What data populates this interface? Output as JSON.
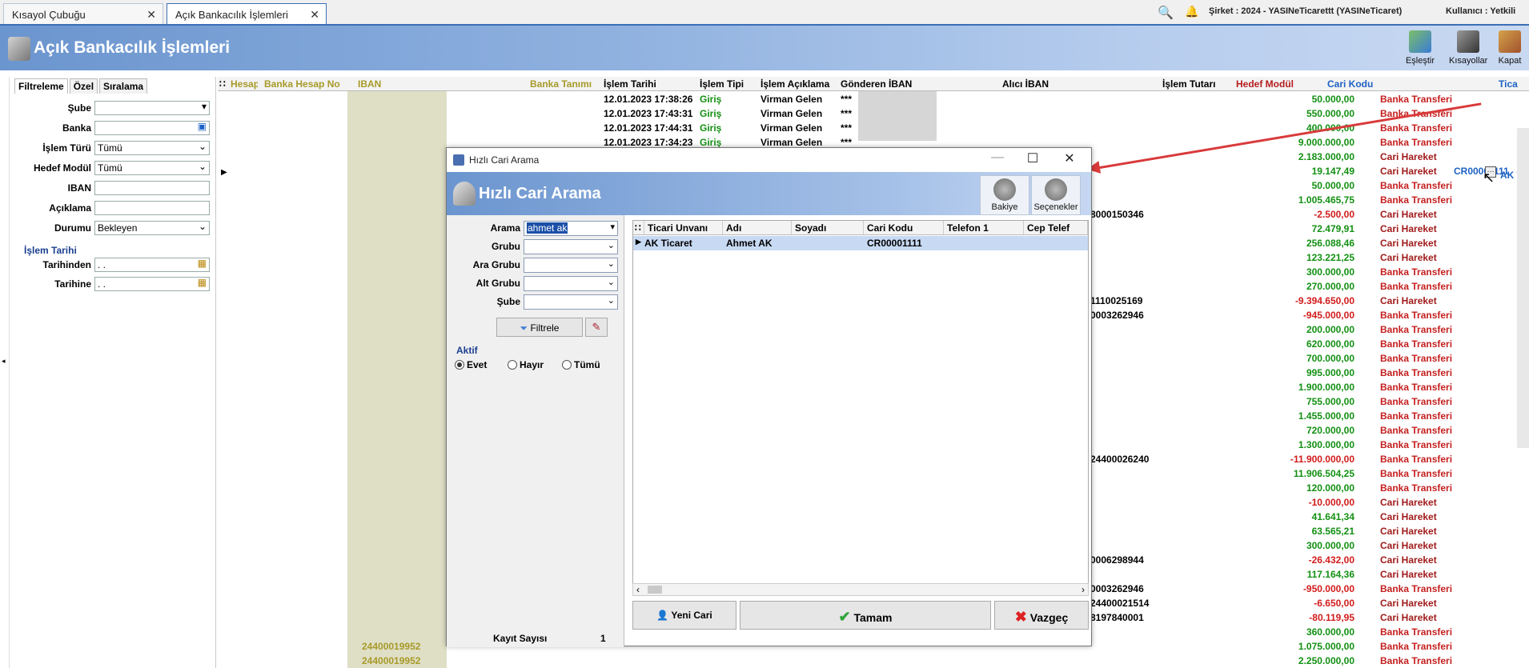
{
  "tabs": [
    {
      "label": "Kısayol Çubuğu"
    },
    {
      "label": "Açık Bankacılık İşlemleri"
    }
  ],
  "topbar": {
    "company": "Şirket : 2024 - YASINeTicarettt (YASINeTicaret)",
    "user": "Kullanıcı : Yetkili"
  },
  "header": {
    "title": "Açık Bankacılık İşlemleri",
    "buttons": [
      "Eşleştir",
      "Kısayollar",
      "Kapat"
    ]
  },
  "leftpanel": {
    "tabs": [
      "Filtreleme",
      "Özel",
      "Sıralama"
    ],
    "fields": [
      {
        "label": "Şube",
        "value": ""
      },
      {
        "label": "Banka",
        "value": ""
      },
      {
        "label": "İşlem Türü",
        "value": "Tümü"
      },
      {
        "label": "Hedef Modül",
        "value": "Tümü"
      },
      {
        "label": "IBAN",
        "value": ""
      },
      {
        "label": "Açıklama",
        "value": ""
      },
      {
        "label": "Durumu",
        "value": "Bekleyen"
      }
    ],
    "date_group": "İşlem Tarihi",
    "date_fields": [
      {
        "label": "Tarihinden",
        "value": ". ."
      },
      {
        "label": "Tarihine",
        "value": ". ."
      }
    ]
  },
  "grid": {
    "columns": [
      "Hesap",
      "Banka Hesap No",
      "IBAN",
      "Banka Tanımı",
      "İşlem Tarihi",
      "İşlem Tipi",
      "İşlem Açıklama",
      "Gönderen İBAN",
      "Alıcı İBAN",
      "İşlem Tutarı",
      "Hedef Modül",
      "Cari Kodu",
      "Tica"
    ],
    "rows": [
      {
        "date": "12.01.2023 17:38:26",
        "type": "Giriş",
        "desc": "Virman Gelen",
        "gond": "***",
        "amount": "50.000,00",
        "module": "Banka Transferi",
        "code": ""
      },
      {
        "date": "12.01.2023 17:43:31",
        "type": "Giriş",
        "desc": "Virman Gelen",
        "gond": "***",
        "amount": "550.000,00",
        "module": "Banka Transferi",
        "code": ""
      },
      {
        "date": "12.01.2023 17:44:31",
        "type": "Giriş",
        "desc": "Virman Gelen",
        "gond": "***",
        "amount": "400.000,00",
        "module": "Banka Transferi",
        "code": ""
      },
      {
        "date": "12.01.2023 17:34:23",
        "type": "Giriş",
        "desc": "Virman Gelen",
        "gond": "***",
        "amount": "9.000.000,00",
        "module": "Banka Transferi",
        "code": ""
      },
      {
        "date": "",
        "type": "",
        "desc": "",
        "gond": "",
        "amount": "2.183.000,00",
        "module": "Cari Hareket",
        "code": ""
      },
      {
        "date": "",
        "type": "",
        "desc": "",
        "gond": "",
        "amount": "19.147,49",
        "module": "Cari Hareket",
        "code": "CR00001111"
      },
      {
        "date": "",
        "type": "",
        "desc": "",
        "gond": "",
        "amount": "50.000,00",
        "module": "Banka Transferi",
        "code": ""
      },
      {
        "date": "",
        "type": "",
        "desc": "",
        "gond": "",
        "amount": "1.005.465,75",
        "module": "Banka Transferi",
        "code": ""
      },
      {
        "date": "",
        "type": "",
        "desc": "",
        "gond": "",
        "amount": "-2.500,00",
        "module": "Cari Hareket",
        "code": ""
      },
      {
        "date": "",
        "type": "",
        "desc": "",
        "gond": "",
        "amount": "72.479,91",
        "module": "Cari Hareket",
        "code": ""
      },
      {
        "date": "",
        "type": "",
        "desc": "",
        "gond": "",
        "amount": "256.088,46",
        "module": "Cari Hareket",
        "code": ""
      },
      {
        "date": "",
        "type": "",
        "desc": "",
        "gond": "",
        "amount": "123.221,25",
        "module": "Cari Hareket",
        "code": ""
      },
      {
        "date": "",
        "type": "",
        "desc": "",
        "gond": "",
        "amount": "300.000,00",
        "module": "Banka Transferi",
        "code": ""
      },
      {
        "date": "",
        "type": "",
        "desc": "",
        "gond": "",
        "amount": "270.000,00",
        "module": "Banka Transferi",
        "code": ""
      },
      {
        "date": "",
        "type": "",
        "desc": "",
        "gond": "",
        "amount": "-9.394.650,00",
        "module": "Cari Hareket",
        "code": ""
      },
      {
        "date": "",
        "type": "",
        "desc": "",
        "gond": "",
        "amount": "-945.000,00",
        "module": "Banka Transferi",
        "code": ""
      },
      {
        "date": "",
        "type": "",
        "desc": "",
        "gond": "",
        "amount": "200.000,00",
        "module": "Banka Transferi",
        "code": ""
      },
      {
        "date": "",
        "type": "",
        "desc": "",
        "gond": "",
        "amount": "620.000,00",
        "module": "Banka Transferi",
        "code": ""
      },
      {
        "date": "",
        "type": "",
        "desc": "",
        "gond": "",
        "amount": "700.000,00",
        "module": "Banka Transferi",
        "code": ""
      },
      {
        "date": "",
        "type": "",
        "desc": "",
        "gond": "",
        "amount": "995.000,00",
        "module": "Banka Transferi",
        "code": ""
      },
      {
        "date": "",
        "type": "",
        "desc": "",
        "gond": "",
        "amount": "1.900.000,00",
        "module": "Banka Transferi",
        "code": ""
      },
      {
        "date": "",
        "type": "",
        "desc": "",
        "gond": "",
        "amount": "755.000,00",
        "module": "Banka Transferi",
        "code": ""
      },
      {
        "date": "",
        "type": "",
        "desc": "",
        "gond": "",
        "amount": "1.455.000,00",
        "module": "Banka Transferi",
        "code": ""
      },
      {
        "date": "",
        "type": "",
        "desc": "",
        "gond": "",
        "amount": "720.000,00",
        "module": "Banka Transferi",
        "code": ""
      },
      {
        "date": "",
        "type": "",
        "desc": "",
        "gond": "",
        "amount": "1.300.000,00",
        "module": "Banka Transferi",
        "code": ""
      },
      {
        "date": "",
        "type": "",
        "desc": "",
        "gond": "",
        "amount": "-11.900.000,00",
        "module": "Banka Transferi",
        "code": ""
      },
      {
        "date": "",
        "type": "",
        "desc": "",
        "gond": "",
        "amount": "11.906.504,25",
        "module": "Banka Transferi",
        "code": ""
      },
      {
        "date": "",
        "type": "",
        "desc": "",
        "gond": "",
        "amount": "120.000,00",
        "module": "Banka Transferi",
        "code": ""
      },
      {
        "date": "",
        "type": "",
        "desc": "",
        "gond": "",
        "amount": "-10.000,00",
        "module": "Cari Hareket",
        "code": ""
      },
      {
        "date": "",
        "type": "",
        "desc": "",
        "gond": "",
        "amount": "41.641,34",
        "module": "Cari Hareket",
        "code": ""
      },
      {
        "date": "",
        "type": "",
        "desc": "",
        "gond": "",
        "amount": "63.565,21",
        "module": "Cari Hareket",
        "code": ""
      },
      {
        "date": "",
        "type": "",
        "desc": "",
        "gond": "",
        "amount": "300.000,00",
        "module": "Cari Hareket",
        "code": ""
      },
      {
        "date": "",
        "type": "",
        "desc": "",
        "gond": "",
        "amount": "-26.432,00",
        "module": "Cari Hareket",
        "code": ""
      },
      {
        "date": "",
        "type": "",
        "desc": "",
        "gond": "",
        "amount": "117.164,36",
        "module": "Cari Hareket",
        "code": ""
      },
      {
        "date": "",
        "type": "",
        "desc": "",
        "gond": "",
        "amount": "-950.000,00",
        "module": "Banka Transferi",
        "code": ""
      },
      {
        "date": "",
        "type": "",
        "desc": "",
        "gond": "",
        "amount": "-6.650,00",
        "module": "Cari Hareket",
        "code": ""
      },
      {
        "date": "",
        "type": "",
        "desc": "",
        "gond": "",
        "amount": "-80.119,95",
        "module": "Cari Hareket",
        "code": ""
      },
      {
        "date": "",
        "type": "",
        "desc": "",
        "gond": "",
        "amount": "360.000,00",
        "module": "Banka Transferi",
        "code": ""
      },
      {
        "date": "",
        "type": "",
        "desc": "",
        "gond": "",
        "amount": "1.075.000,00",
        "module": "Banka Transferi",
        "code": ""
      },
      {
        "date": "",
        "type": "",
        "desc": "",
        "gond": "",
        "amount": "2.250.000,00",
        "module": "Banka Transferi",
        "code": ""
      }
    ],
    "partial_texts": [
      {
        "text": "8000150346",
        "row": 8
      },
      {
        "text": "1110025169",
        "row": 14
      },
      {
        "text": "0003262946",
        "row": 15
      },
      {
        "text": "24400026240",
        "row": 25
      },
      {
        "text": "0006298944",
        "row": 32
      },
      {
        "text": "0003262946",
        "row": 34
      },
      {
        "text": "24400021514",
        "row": 35
      },
      {
        "text": "8197840001",
        "row": 36
      },
      {
        "text": "24400019952",
        "row": 38
      },
      {
        "text": "24400019952",
        "row": 39
      }
    ],
    "trailing_code": "AK T"
  },
  "dialog": {
    "window_title": "Hızlı Cari Arama",
    "header_title": "Hızlı Cari Arama",
    "header_buttons": [
      "Bakiye",
      "Seçenekler"
    ],
    "fields": [
      {
        "label": "Arama",
        "value": "ahmet ak"
      },
      {
        "label": "Grubu",
        "value": ""
      },
      {
        "label": "Ara Grubu",
        "value": ""
      },
      {
        "label": "Alt Grubu",
        "value": ""
      },
      {
        "label": "Şube",
        "value": ""
      }
    ],
    "filter_button": "Filtrele",
    "aktif_label": "Aktif",
    "radios": [
      {
        "label": "Evet",
        "checked": true
      },
      {
        "label": "Hayır",
        "checked": false
      },
      {
        "label": "Tümü",
        "checked": false
      }
    ],
    "kayit_label": "Kayıt Sayısı",
    "kayit_value": "1",
    "columns": [
      "Ticari Unvanı",
      "Adı",
      "Soyadı",
      "Cari Kodu",
      "Telefon 1",
      "Cep Telef"
    ],
    "rows": [
      {
        "unvan": "AK Ticaret",
        "adi": "Ahmet AK",
        "soyadi": "",
        "kod": "CR00001111",
        "tel": "",
        "cep": ""
      }
    ],
    "buttons": {
      "new": "Yeni Cari",
      "ok": "Tamam",
      "cancel": "Vazgeç"
    }
  },
  "colors": {
    "accent": "#3b6fb6",
    "positive": "#139013",
    "negative": "#d21b1b",
    "arrow": "#d93a3a"
  }
}
